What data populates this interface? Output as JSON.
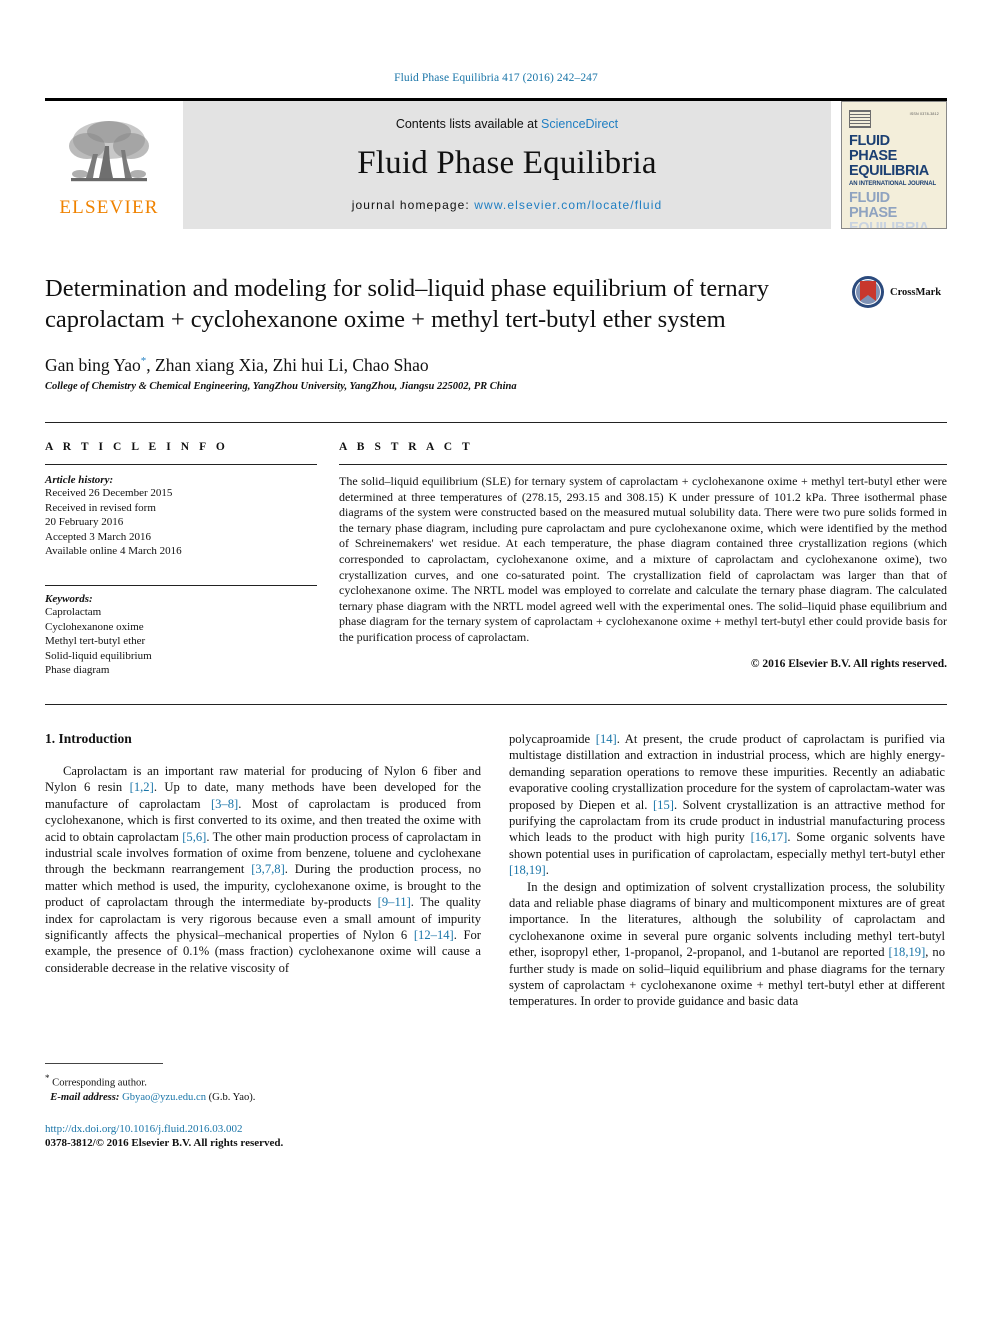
{
  "running_head": "Fluid Phase Equilibria 417 (2016) 242–247",
  "masthead": {
    "publisher_logo_label": "ELSEVIER",
    "contents_prefix": "Contents lists available at ",
    "contents_link": "ScienceDirect",
    "journal_name": "Fluid Phase Equilibria",
    "homepage_prefix": "journal homepage: ",
    "homepage_url": "www.elsevier.com/locate/fluid",
    "cover": {
      "issn_text": "ISSN 0378-3812",
      "title_line_1": "FLUID PHASE",
      "title_line_2": "EQUILIBRIA",
      "subtitle": "AN INTERNATIONAL JOURNAL",
      "ghost_line_1": "FLUID PHASE",
      "ghost_line_2": "EQUILIBRIA"
    }
  },
  "article": {
    "title": "Determination and modeling for solid–liquid phase equilibrium of ternary caprolactam + cyclohexanone oxime + methyl tert-butyl ether system",
    "crossmark_label": "CrossMark",
    "authors": "Gan bing Yao",
    "authors_rest": ", Zhan xiang Xia, Zhi hui Li, Chao Shao",
    "corresponding_marker": "*",
    "affiliation": "College of Chemistry & Chemical Engineering, YangZhou University, YangZhou, Jiangsu 225002, PR China"
  },
  "info": {
    "heading": "A R T I C L E   I N F O",
    "history_label": "Article history:",
    "history_lines": [
      "Received 26 December 2015",
      "Received in revised form",
      "20 February 2016",
      "Accepted 3 March 2016",
      "Available online 4 March 2016"
    ],
    "keywords_label": "Keywords:",
    "keywords": [
      "Caprolactam",
      "Cyclohexanone oxime",
      "Methyl tert-butyl ether",
      "Solid-liquid equilibrium",
      "Phase diagram"
    ]
  },
  "abstract": {
    "heading": "A B S T R A C T",
    "text": "The solid–liquid equilibrium (SLE) for ternary system of caprolactam + cyclohexanone oxime + methyl tert-butyl ether were determined at three temperatures of (278.15, 293.15 and 308.15) K under pressure of 101.2 kPa. Three isothermal phase diagrams of the system were constructed based on the measured mutual solubility data. There were two pure solids formed in the ternary phase diagram, including pure caprolactam and pure cyclohexanone oxime, which were identified by the method of Schreinemakers' wet residue. At each temperature, the phase diagram contained three crystallization regions (which corresponded to caprolactam, cyclohexanone oxime, and a mixture of caprolactam and cyclohexanone oxime), two crystallization curves, and one co-saturated point. The crystallization field of caprolactam was larger than that of cyclohexanone oxime. The NRTL model was employed to correlate and calculate the ternary phase diagram. The calculated ternary phase diagram with the NRTL model agreed well with the experimental ones. The solid–liquid phase equilibrium and phase diagram for the ternary system of caprolactam + cyclohexanone oxime + methyl tert-butyl ether could provide basis for the purification process of caprolactam.",
    "copyright": "© 2016 Elsevier B.V. All rights reserved."
  },
  "introduction": {
    "heading": "1. Introduction",
    "left_para_1_a": "Caprolactam is an important raw material for producing of Nylon 6 fiber and Nylon 6 resin ",
    "left_ref_1": "[1,2]",
    "left_para_1_b": ". Up to date, many methods have been developed for the manufacture of caprolactam ",
    "left_ref_2": "[3–8]",
    "left_para_1_c": ". Most of caprolactam is produced from cyclohexanone, which is first converted to its oxime, and then treated the oxime with acid to obtain caprolactam ",
    "left_ref_3": "[5,6]",
    "left_para_1_d": ". The other main production process of caprolactam in industrial scale involves formation of oxime from benzene, toluene and cyclohexane through the beckmann rearrangement ",
    "left_ref_4": "[3,7,8]",
    "left_para_1_e": ". During the production process, no matter which method is used, the impurity, cyclohexanone oxime, is brought to the product of caprolactam through the intermediate by-products ",
    "left_ref_5": "[9–11]",
    "left_para_1_f": ". The quality index for caprolactam is very rigorous because even a small amount of impurity significantly affects the physical–mechanical properties of Nylon 6 ",
    "left_ref_6": "[12–14]",
    "left_para_1_g": ". For example, the presence of 0.1% (mass fraction) cyclohexanone oxime will cause a considerable decrease in the relative viscosity of",
    "right_para_1_a": "polycaproamide ",
    "right_ref_1": "[14]",
    "right_para_1_b": ". At present, the crude product of caprolactam is purified via multistage distillation and extraction in industrial process, which are highly energy-demanding separation operations to remove these impurities. Recently an adiabatic evaporative cooling crystallization procedure for the system of caprolactam-water was proposed by Diepen et al. ",
    "right_ref_2": "[15]",
    "right_para_1_c": ". Solvent crystallization is an attractive method for purifying the caprolactam from its crude product in industrial manufacturing process which leads to the product with high purity ",
    "right_ref_3": "[16,17]",
    "right_para_1_d": ". Some organic solvents have shown potential uses in purification of caprolactam, especially methyl tert-butyl ether ",
    "right_ref_4": "[18,19]",
    "right_para_1_e": ".",
    "right_para_2_a": "In the design and optimization of solvent crystallization process, the solubility data and reliable phase diagrams of binary and multicomponent mixtures are of great importance. In the literatures, although the solubility of caprolactam and cyclohexanone oxime in several pure organic solvents including methyl tert-butyl ether, isopropyl ether, 1-propanol, 2-propanol, and 1-butanol are reported ",
    "right_ref_5": "[18,19]",
    "right_para_2_b": ", no further study is made on solid–liquid equilibrium and phase diagrams for the ternary system of caprolactam + cyclohexanone oxime + methyl tert-butyl ether at different temperatures. In order to provide guidance and basic data"
  },
  "footnote": {
    "corresponding": "Corresponding author.",
    "email_label": "E-mail address:",
    "email": "Gbyao@yzu.edu.cn",
    "email_suffix": " (G.b. Yao).",
    "doi": "http://dx.doi.org/10.1016/j.fluid.2016.03.002",
    "issn_copyright": "0378-3812/© 2016 Elsevier B.V. All rights reserved."
  },
  "colors": {
    "link": "#1a75a8",
    "elsevier_orange": "#ef8200",
    "masthead_bg": "#e3e3e3",
    "cover_bg": "#f3eeda",
    "cover_text": "#1b3f72",
    "crossmark_red": "#c8372d",
    "crossmark_blue": "#2b4a7d"
  }
}
